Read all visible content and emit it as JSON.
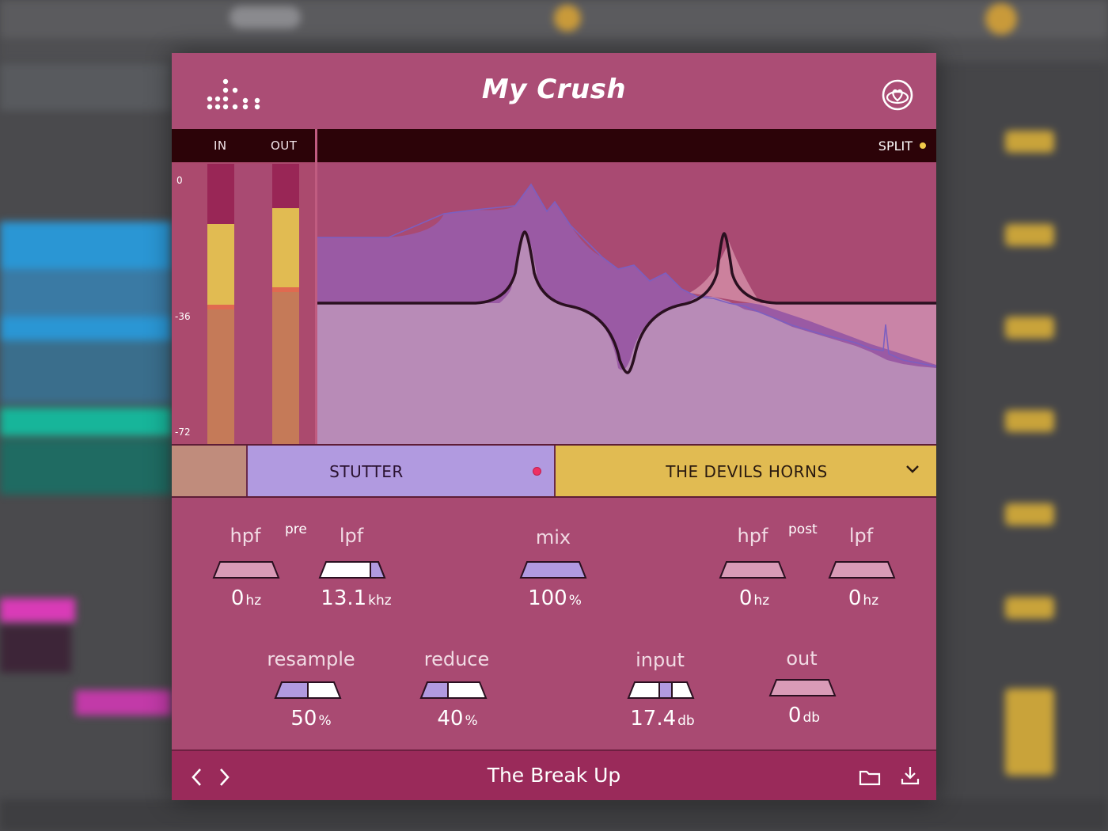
{
  "plugin": {
    "title": "My Crush",
    "logo_icon": "dots-logo-icon",
    "favorite_icon": "heart-icon"
  },
  "meters": {
    "in_label": "IN",
    "out_label": "OUT",
    "split_label": "SPLIT",
    "scale": [
      "0",
      "-36",
      "-72"
    ]
  },
  "presets": {
    "stutter_label": "STUTTER",
    "devils_label": "THE DEVILS HORNS",
    "colors": {
      "stutter": "#b19ae0",
      "devils": "#e1bb52",
      "swatch": "#c08c7c"
    }
  },
  "controls": {
    "pre_label": "pre",
    "post_label": "post",
    "pre_hpf": {
      "label": "hpf",
      "value": "0",
      "unit": "hz"
    },
    "pre_lpf": {
      "label": "lpf",
      "value": "13.1",
      "unit": "khz"
    },
    "mix": {
      "label": "mix",
      "value": "100",
      "unit": "%"
    },
    "post_hpf": {
      "label": "hpf",
      "value": "0",
      "unit": "hz"
    },
    "post_lpf": {
      "label": "lpf",
      "value": "0",
      "unit": "hz"
    },
    "resample": {
      "label": "resample",
      "value": "50",
      "unit": "%"
    },
    "reduce": {
      "label": "reduce",
      "value": "40",
      "unit": "%"
    },
    "input": {
      "label": "input",
      "value": "17.4",
      "unit": "db"
    },
    "out": {
      "label": "out",
      "value": "0",
      "unit": "db"
    }
  },
  "footer": {
    "preset_name": "The Break Up",
    "prev_icon": "chevron-left-icon",
    "next_icon": "chevron-right-icon",
    "folder_icon": "folder-icon",
    "download_icon": "download-icon"
  }
}
